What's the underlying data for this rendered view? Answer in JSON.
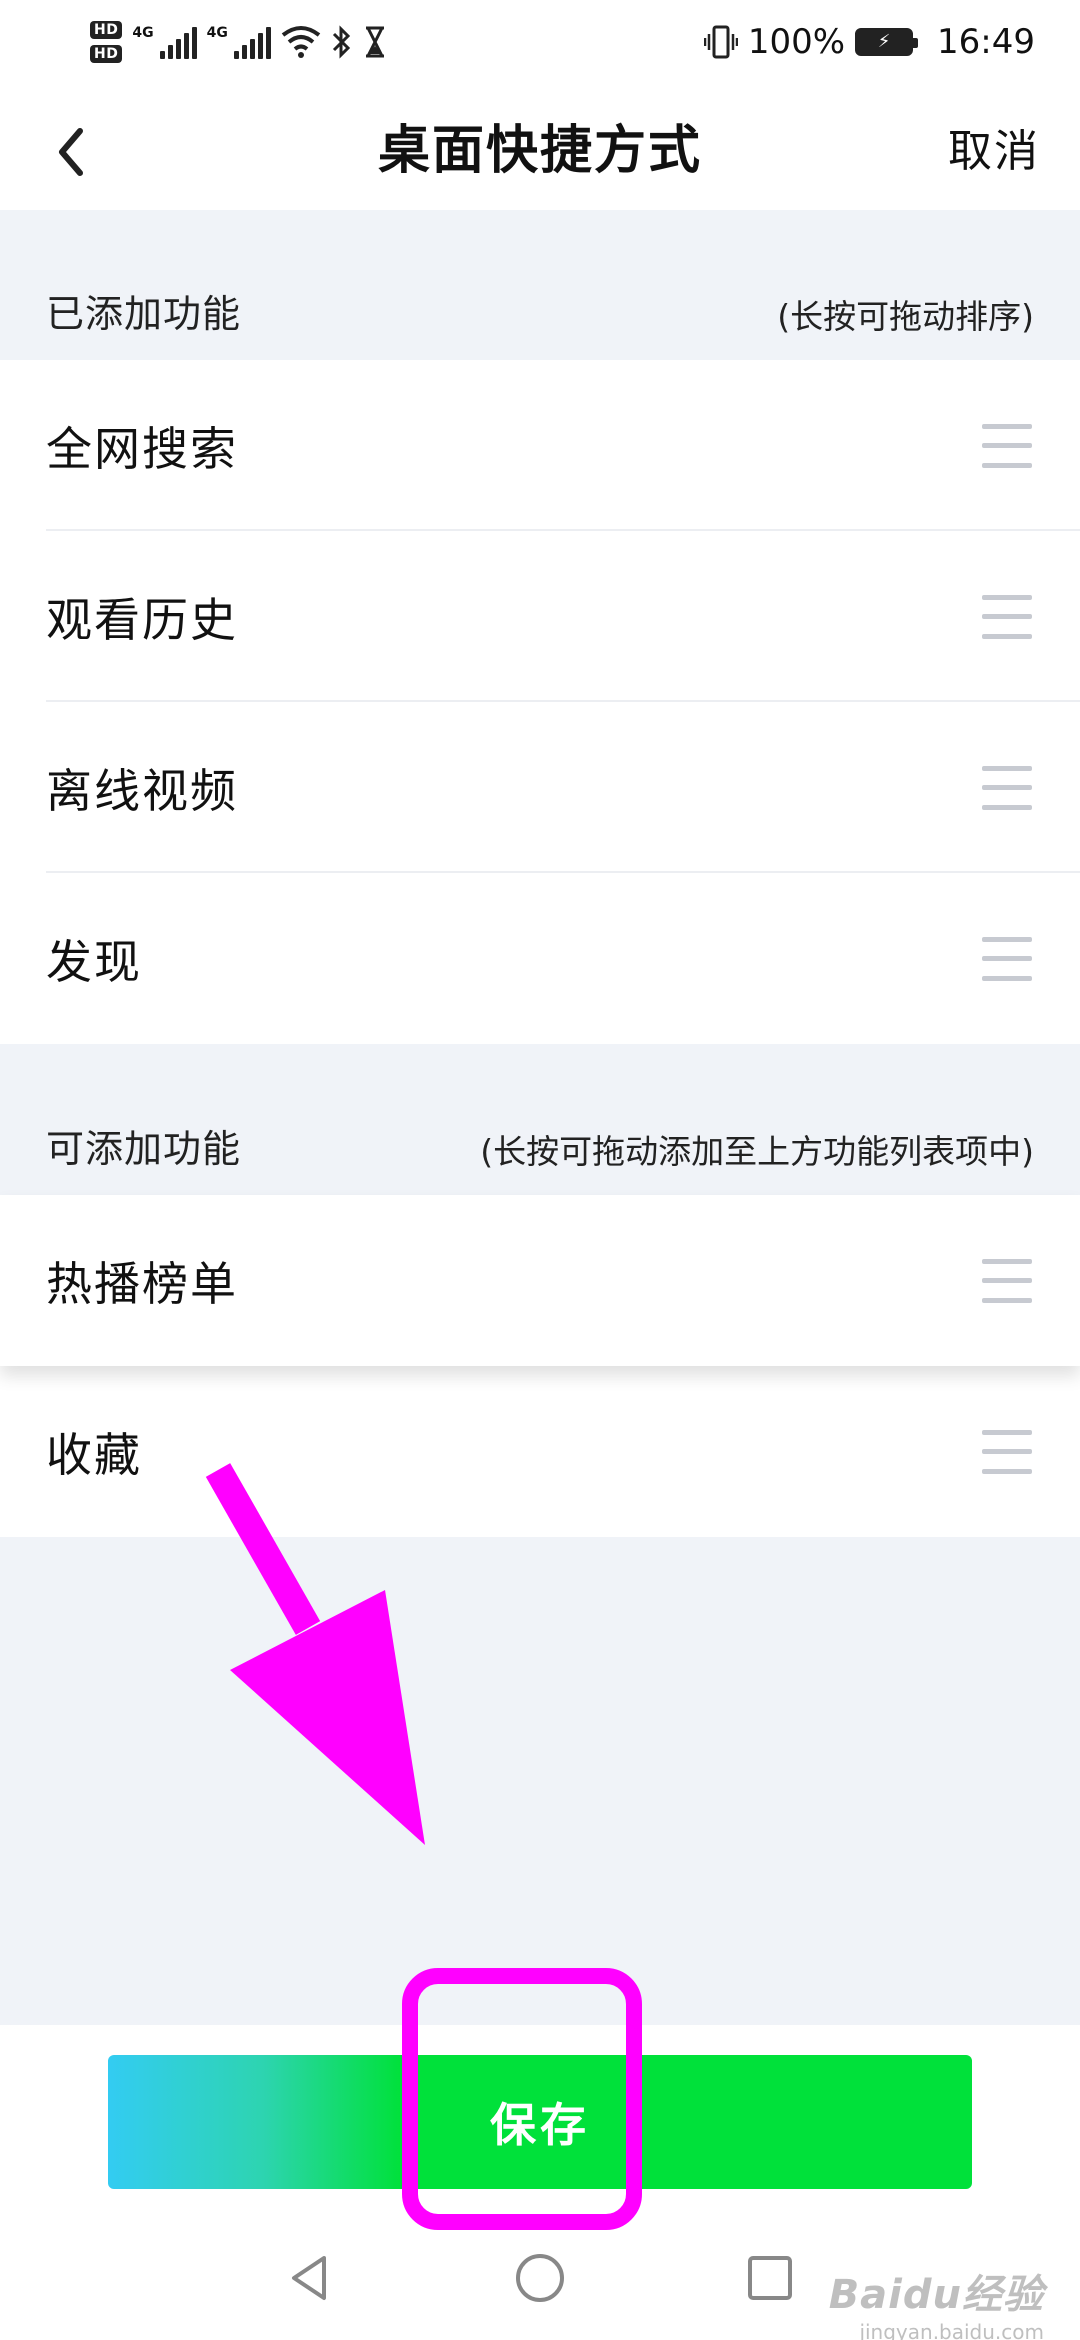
{
  "status_bar": {
    "hd1": "HD",
    "hd2": "HD",
    "net1": "4G",
    "net2": "4G",
    "battery_percent": "100%",
    "time": "16:49"
  },
  "header": {
    "title": "桌面快捷方式",
    "cancel_label": "取消"
  },
  "added_section": {
    "title": "已添加功能",
    "hint": "(长按可拖动排序)",
    "items": [
      {
        "label": "全网搜索"
      },
      {
        "label": "观看历史"
      },
      {
        "label": "离线视频"
      },
      {
        "label": "发现"
      }
    ]
  },
  "available_section": {
    "title": "可添加功能",
    "hint": "(长按可拖动添加至上方功能列表项中)",
    "items": [
      {
        "label": "热播榜单"
      },
      {
        "label": "收藏"
      }
    ]
  },
  "save_button": {
    "label": "保存"
  },
  "watermark": {
    "main": "Baidu经验",
    "sub": "jingyan.baidu.com"
  },
  "colors": {
    "accent_green": "#00e13a",
    "gradient_start": "#33ccf2",
    "annotation_magenta": "#ff00ff",
    "page_background": "#f0f3f8"
  },
  "icons": {
    "back": "chevron-left-icon",
    "drag": "drag-handle-icon",
    "nav_back": "triangle-back-icon",
    "nav_home": "circle-home-icon",
    "nav_recents": "square-recents-icon"
  }
}
